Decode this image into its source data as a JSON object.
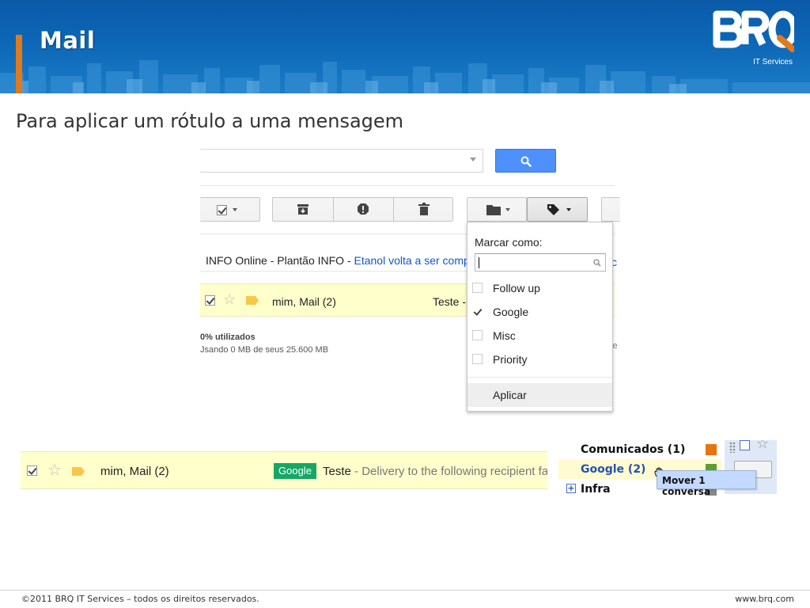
{
  "slide": {
    "title": "Mail",
    "subtitle": "Para aplicar um rótulo a uma mensagem",
    "logo_sub": "IT Services",
    "footer_left": "©2011 BRQ IT Services – todos os direitos reservados.",
    "footer_right": "www.brq.com"
  },
  "gmail": {
    "promo_source": "INFO Online - Plantão INFO - ",
    "promo_link": "Etanol volta a ser comp",
    "row": {
      "from": "mim, Mail (2)",
      "subject": "Teste -"
    },
    "quota_line1": "0% utilizados",
    "quota_line2": "Jsando 0 MB de seus 25.600 MB",
    "label_menu": {
      "header": "Marcar como:",
      "items": [
        {
          "label": "Follow up",
          "checked": false
        },
        {
          "label": "Google",
          "checked": true
        },
        {
          "label": "Misc",
          "checked": false
        },
        {
          "label": "Priority",
          "checked": false
        }
      ],
      "apply": "Aplicar"
    }
  },
  "labeled_row": {
    "from": "mim, Mail (2)",
    "tag": "Google",
    "subject": "Teste",
    "snippet": " - Delivery to the following recipient fa"
  },
  "drag_panel": {
    "labels": [
      {
        "name": "Comunicados (1)",
        "color": "#e8740c"
      },
      {
        "name": "Google (2)",
        "color": "#5e9e2e"
      },
      {
        "name": "Infra",
        "color": "#888888"
      }
    ],
    "tooltip": "Mover 1 conversa"
  },
  "colors": {
    "banner": "#0d67b6",
    "accent": "#e07a1c",
    "gmail_blue": "#4d90fe",
    "google_tag": "#16a765",
    "selected_row": "#ffffcc"
  }
}
